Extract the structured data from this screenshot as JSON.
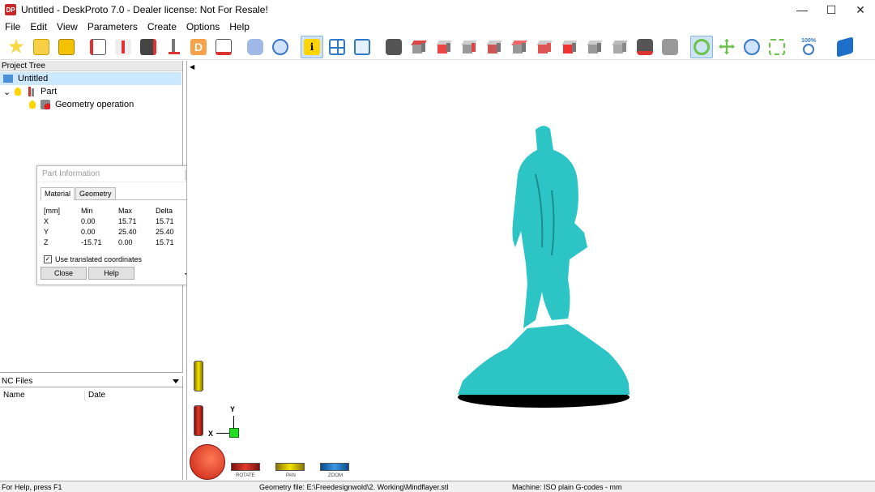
{
  "window": {
    "title": "Untitled - DeskProto 7.0 - Dealer license: Not For Resale!",
    "logo_text": "DP",
    "minimize": "—",
    "maximize": "☐",
    "close": "✕"
  },
  "menu": [
    "File",
    "Edit",
    "View",
    "Parameters",
    "Create",
    "Options",
    "Help"
  ],
  "toolbar": {
    "zoom_level": "100%"
  },
  "project_tree": {
    "header": "Project Tree",
    "root": "Untitled",
    "part": "Part",
    "operation": "Geometry operation",
    "expander": "⌄"
  },
  "nc_files": {
    "header": "NC Files",
    "col_name": "Name",
    "col_date": "Date"
  },
  "part_info": {
    "title": "Part Information",
    "tabs": [
      "Material",
      "Geometry"
    ],
    "rows": [
      [
        "[mm]",
        "Min",
        "Max",
        "Delta"
      ],
      [
        "X",
        "0.00",
        "15.71",
        "15.71"
      ],
      [
        "Y",
        "0.00",
        "25.40",
        "25.40"
      ],
      [
        "Z",
        "-15.71",
        "0.00",
        "15.71"
      ]
    ],
    "checkbox_label": "Use translated coordinates",
    "checked": true,
    "close_btn": "Close",
    "help_btn": "Help"
  },
  "viewport": {
    "axis_y": "Y",
    "axis_x": "X",
    "rotate": "ROTATE",
    "pan": "PAN",
    "zoom": "ZOOM",
    "model_color": "#2cc4c4"
  },
  "status": {
    "help": "For Help, press F1",
    "geometry": "Geometry file: E:\\Freedesignwold\\2. Working\\Mindflayer.stl",
    "machine": "Machine: ISO plain G-codes - mm"
  }
}
